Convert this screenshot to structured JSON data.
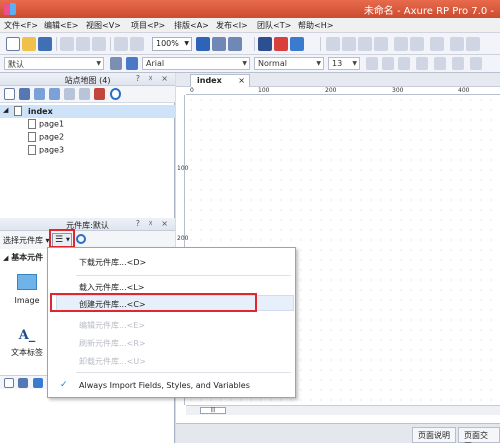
{
  "window": {
    "title": "未命名 - Axure RP Pro 7.0 -"
  },
  "menubar": {
    "items": [
      "文件<F>",
      "编辑<E>",
      "视图<V>",
      "项目<P>",
      "排版<A>",
      "发布<I>",
      "团队<T>",
      "帮助<H>"
    ]
  },
  "toolbar": {
    "zoom": "100%"
  },
  "format_bar": {
    "style": "默认",
    "font": "Arial",
    "weight": "Normal",
    "size": "13"
  },
  "sitemap": {
    "title": "站点地图 (4)",
    "controls": "? ☓ ×",
    "root": "index",
    "pages": [
      "page1",
      "page2",
      "page3"
    ]
  },
  "library": {
    "title": "元件库:默认",
    "controls": "? ☓ ×",
    "select_label": "选择元件库",
    "section": "基本元件",
    "widgets": [
      {
        "label": "Image",
        "icon": "image-icon"
      },
      {
        "label": "文本标签",
        "icon": "text-label-icon",
        "glyph": "A_"
      }
    ]
  },
  "canvas": {
    "tab": "index",
    "ruler_h": [
      "0",
      "100",
      "200",
      "300",
      "400"
    ],
    "ruler_v": [
      "100",
      "200",
      "300"
    ],
    "scroll_thumb": "|||",
    "bottom_tabs": [
      "页面说明",
      "页面交互"
    ]
  },
  "dropdown_menu": {
    "items": [
      {
        "label": "下载元件库...<D>",
        "enabled": true
      },
      {
        "label": "载入元件库...<L>",
        "enabled": true
      },
      {
        "label": "创建元件库...<C>",
        "enabled": true,
        "highlighted": true
      },
      {
        "label": "编辑元件库...<E>",
        "enabled": false
      },
      {
        "label": "刷新元件库...<R>",
        "enabled": false
      },
      {
        "label": "卸载元件库...<U>",
        "enabled": false
      },
      {
        "label": "Always Import Fields, Styles, and Variables",
        "enabled": true,
        "checked": true
      }
    ]
  },
  "colors": {
    "titlebar": "#d9573a",
    "highlight": "#e0262e",
    "accent": "#1c7fd6"
  }
}
